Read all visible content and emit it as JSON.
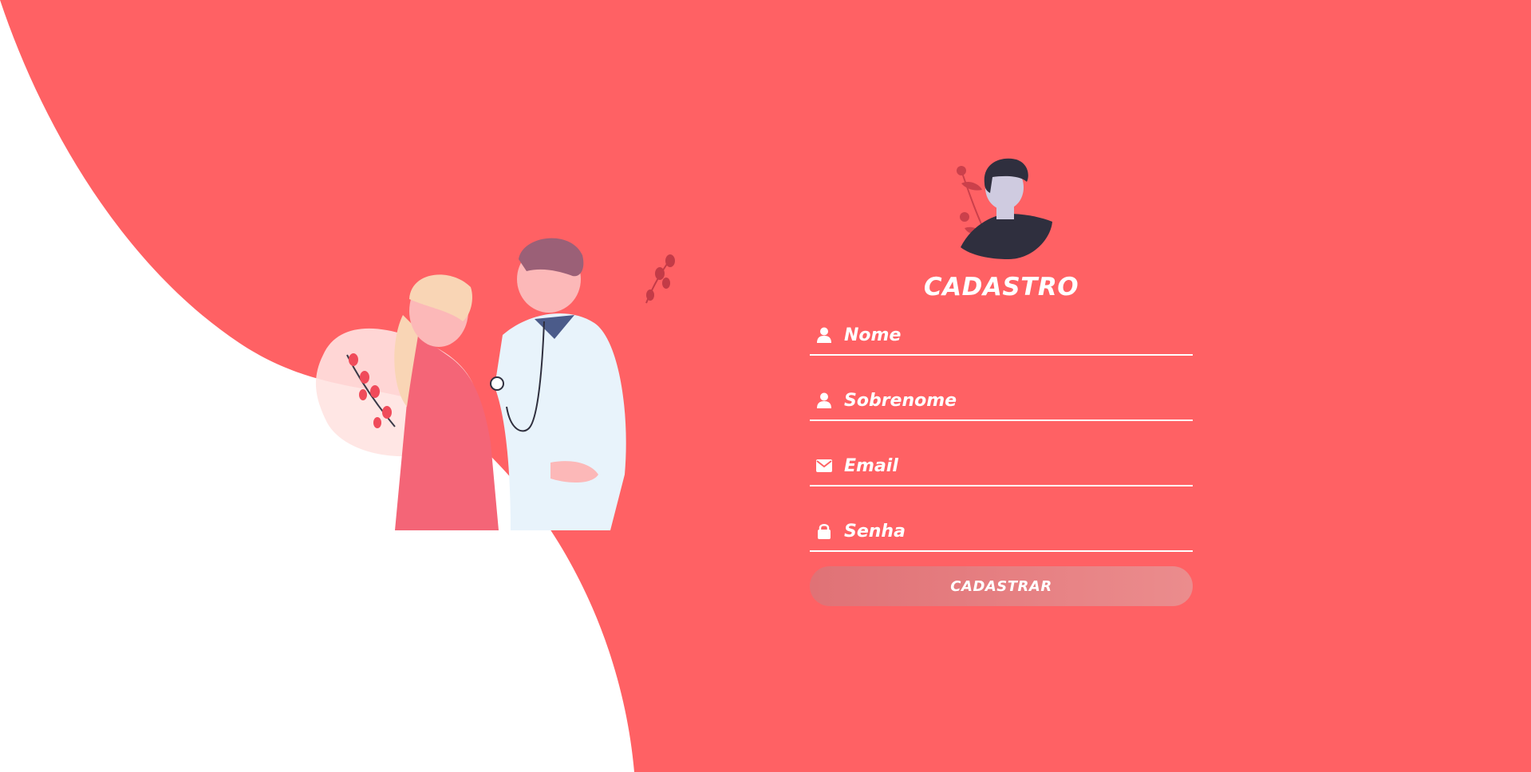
{
  "form": {
    "title": "CADASTRO",
    "fields": [
      {
        "icon": "user-icon",
        "placeholder": "Nome",
        "value": ""
      },
      {
        "icon": "user-icon",
        "placeholder": "Sobrenome",
        "value": ""
      },
      {
        "icon": "envelope-icon",
        "placeholder": "Email",
        "value": ""
      },
      {
        "icon": "lock-icon",
        "placeholder": "Senha",
        "value": ""
      }
    ],
    "submit_label": "CADASTRAR"
  },
  "colors": {
    "background": "#ff6164",
    "wave": "#ffffff",
    "text": "#ffffff",
    "button_start": "#e07276",
    "button_end": "#eb8c8d"
  },
  "images": {
    "avatar": "avatar-illustration",
    "doctor_scene": "doctor-patient-illustration"
  }
}
